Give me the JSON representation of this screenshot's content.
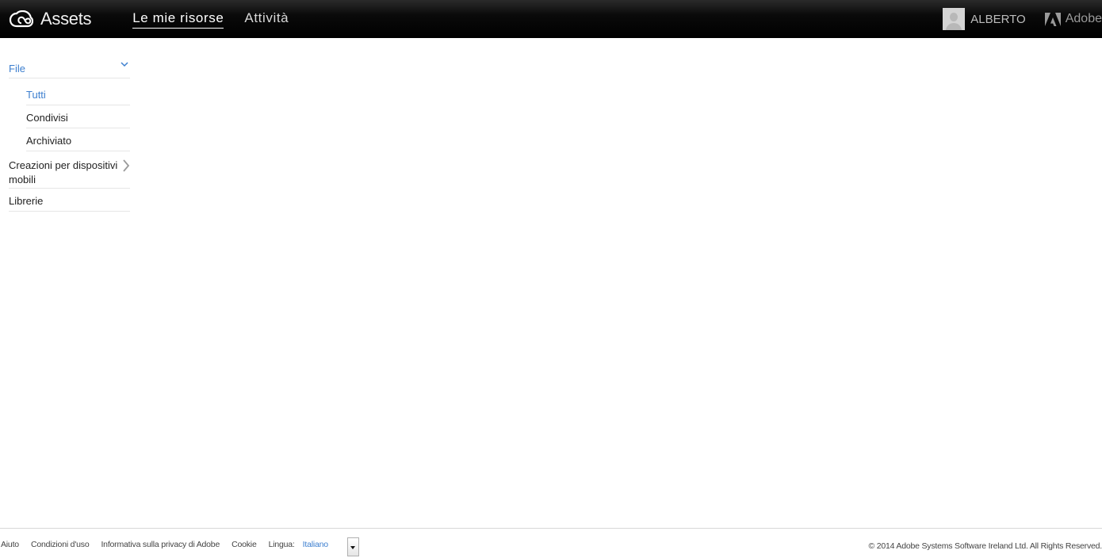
{
  "header": {
    "app_name": "Assets",
    "nav": [
      {
        "label": "Le mie risorse",
        "active": true
      },
      {
        "label": "Attività",
        "active": false
      }
    ],
    "user_name": "ALBERTO",
    "vendor": "Adobe",
    "background": "#000000"
  },
  "sidebar": {
    "accent_color": "#3d7fcf",
    "file_section": {
      "label": "File",
      "expanded": true,
      "icon": "chevron-down-icon",
      "items": [
        {
          "label": "Tutti",
          "selected": true
        },
        {
          "label": "Condivisi",
          "selected": false
        },
        {
          "label": "Archiviato",
          "selected": false
        }
      ]
    },
    "mobile_section": {
      "label": "Creazioni per dispositivi mobili",
      "icon": "chevron-right-icon"
    },
    "libraries_section": {
      "label": "Librerie"
    }
  },
  "footer": {
    "links": [
      "Aiuto",
      "Condizioni d'uso",
      "Informativa sulla privacy di Adobe",
      "Cookie"
    ],
    "language_label": "Lingua:",
    "language_value": "Italiano",
    "copyright": "© 2014 Adobe Systems Software Ireland Ltd. All Rights Reserved."
  }
}
